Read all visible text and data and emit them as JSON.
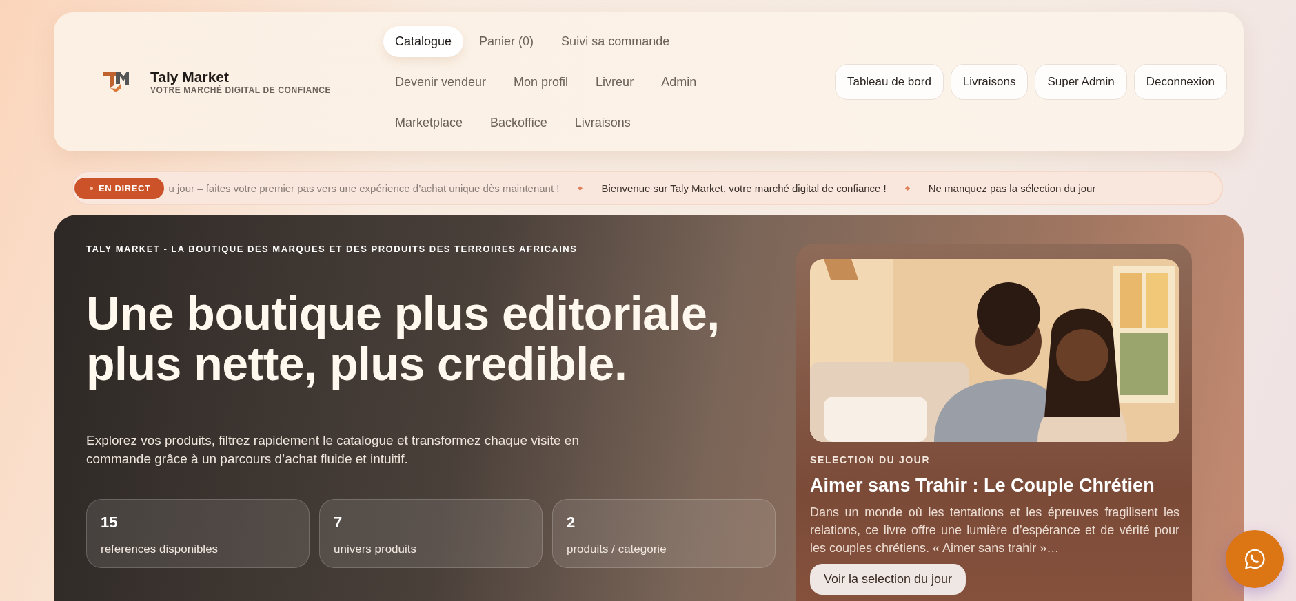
{
  "brand": {
    "name": "Taly Market",
    "tagline": "VOTRE MARCHÉ DIGITAL DE CONFIANCE"
  },
  "nav": {
    "rows": [
      [
        {
          "label": "Catalogue",
          "selected": true
        },
        {
          "label": "Panier (0)",
          "selected": false
        },
        {
          "label": "Suivi sa commande",
          "selected": false
        }
      ],
      [
        {
          "label": "Devenir vendeur",
          "selected": false
        },
        {
          "label": "Mon profil",
          "selected": false
        },
        {
          "label": "Livreur",
          "selected": false
        },
        {
          "label": "Admin",
          "selected": false
        }
      ],
      [
        {
          "label": "Marketplace",
          "selected": false
        },
        {
          "label": "Backoffice",
          "selected": false
        },
        {
          "label": "Livraisons",
          "selected": false
        }
      ]
    ]
  },
  "actions": [
    "Tableau de bord",
    "Livraisons",
    "Super Admin",
    "Deconnexion"
  ],
  "ticker": {
    "badge": "EN DIRECT",
    "items": [
      "u jour – faites votre premier pas vers une expérience d’achat unique dès maintenant !",
      "Bienvenue sur Taly Market, votre marché digital de confiance !",
      "Ne manquez pas la sélection du jour"
    ]
  },
  "hero": {
    "kicker": "TALY MARKET - LA BOUTIQUE DES MARQUES ET DES PRODUITS DES TERROIRES AFRICAINS",
    "title_lines": [
      "Une boutique plus editoriale,",
      "plus nette, plus credible."
    ],
    "intro": "Explorez vos produits, filtrez rapidement le catalogue et transformez chaque visite en commande grâce à un parcours d’achat fluide et intuitif.",
    "stats": [
      {
        "value": "15",
        "label": "references disponibles"
      },
      {
        "value": "7",
        "label": "univers produits"
      },
      {
        "value": "2",
        "label": "produits / categorie"
      }
    ]
  },
  "feature": {
    "kicker": "SELECTION DU JOUR",
    "title": "Aimer sans Trahir : Le Couple Chrétien",
    "description": "Dans un monde où les tentations et les épreuves fragilisent les relations, ce livre offre une lumière d’espérance et de vérité pour les couples chrétiens. « Aimer sans trahir »…",
    "button": "Voir la selection du jour"
  }
}
